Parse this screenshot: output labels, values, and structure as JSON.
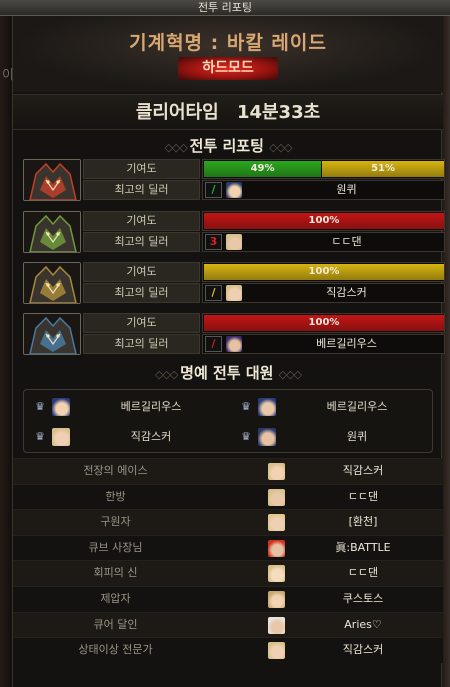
{
  "window": {
    "title": "전투 리포팅"
  },
  "background_text": "이리네",
  "raid": {
    "title": "기계혁명 : 바칼 레이드",
    "mode": "하드모드"
  },
  "clear": {
    "label": "클리어타임",
    "time": "14분33초"
  },
  "report": {
    "heading": "전투 리포팅",
    "contribution_label": "기여도",
    "top_dealer_label": "최고의 딜러",
    "bosses": [
      {
        "icon": "fire-dragon-portrait",
        "accent": "#c0402a",
        "contribution": [
          {
            "label": "49%",
            "value": 49,
            "color": "#2aa81e"
          },
          {
            "label": "51%",
            "value": 51,
            "color": "#d7b410"
          }
        ],
        "dealer": {
          "job_icon": "/",
          "job_color": "#21b821",
          "name": "원퀴"
        }
      },
      {
        "icon": "green-dragon-portrait",
        "accent": "#6f9a3a",
        "contribution": [
          {
            "label": "100%",
            "value": 100,
            "color": "#c41414"
          }
        ],
        "dealer": {
          "job_icon": "3",
          "job_color": "#d42020",
          "name": "ㄷㄷ댄"
        }
      },
      {
        "icon": "gold-dragon-portrait",
        "accent": "#a88a3a",
        "contribution": [
          {
            "label": "100%",
            "value": 100,
            "color": "#d7b410"
          }
        ],
        "dealer": {
          "job_icon": "/",
          "job_color": "#e0c020",
          "name": "직감스커"
        }
      },
      {
        "icon": "ice-dragon-portrait",
        "accent": "#4a7aa0",
        "contribution": [
          {
            "label": "100%",
            "value": 100,
            "color": "#c41414"
          }
        ],
        "dealer": {
          "job_icon": "/",
          "job_color": "#c02020",
          "name": "베르길리우스"
        }
      }
    ]
  },
  "honor": {
    "heading": "명예 전투 대원",
    "members": [
      {
        "name": "베르길리우스"
      },
      {
        "name": "베르길리우스"
      },
      {
        "name": "직감스커"
      },
      {
        "name": "원퀴"
      }
    ]
  },
  "awards": [
    {
      "title": "전장의 에이스",
      "name": "직감스커"
    },
    {
      "title": "한방",
      "name": "ㄷㄷ댄"
    },
    {
      "title": "구원자",
      "name": "[환천]"
    },
    {
      "title": "큐브 사장님",
      "name": "眞:BATTLE"
    },
    {
      "title": "회피의 신",
      "name": "ㄷㄷ댄"
    },
    {
      "title": "제압자",
      "name": "쿠스토스"
    },
    {
      "title": "큐어 달인",
      "name": "Aries♡"
    },
    {
      "title": "상태이상 전문가",
      "name": "직감스커"
    }
  ]
}
